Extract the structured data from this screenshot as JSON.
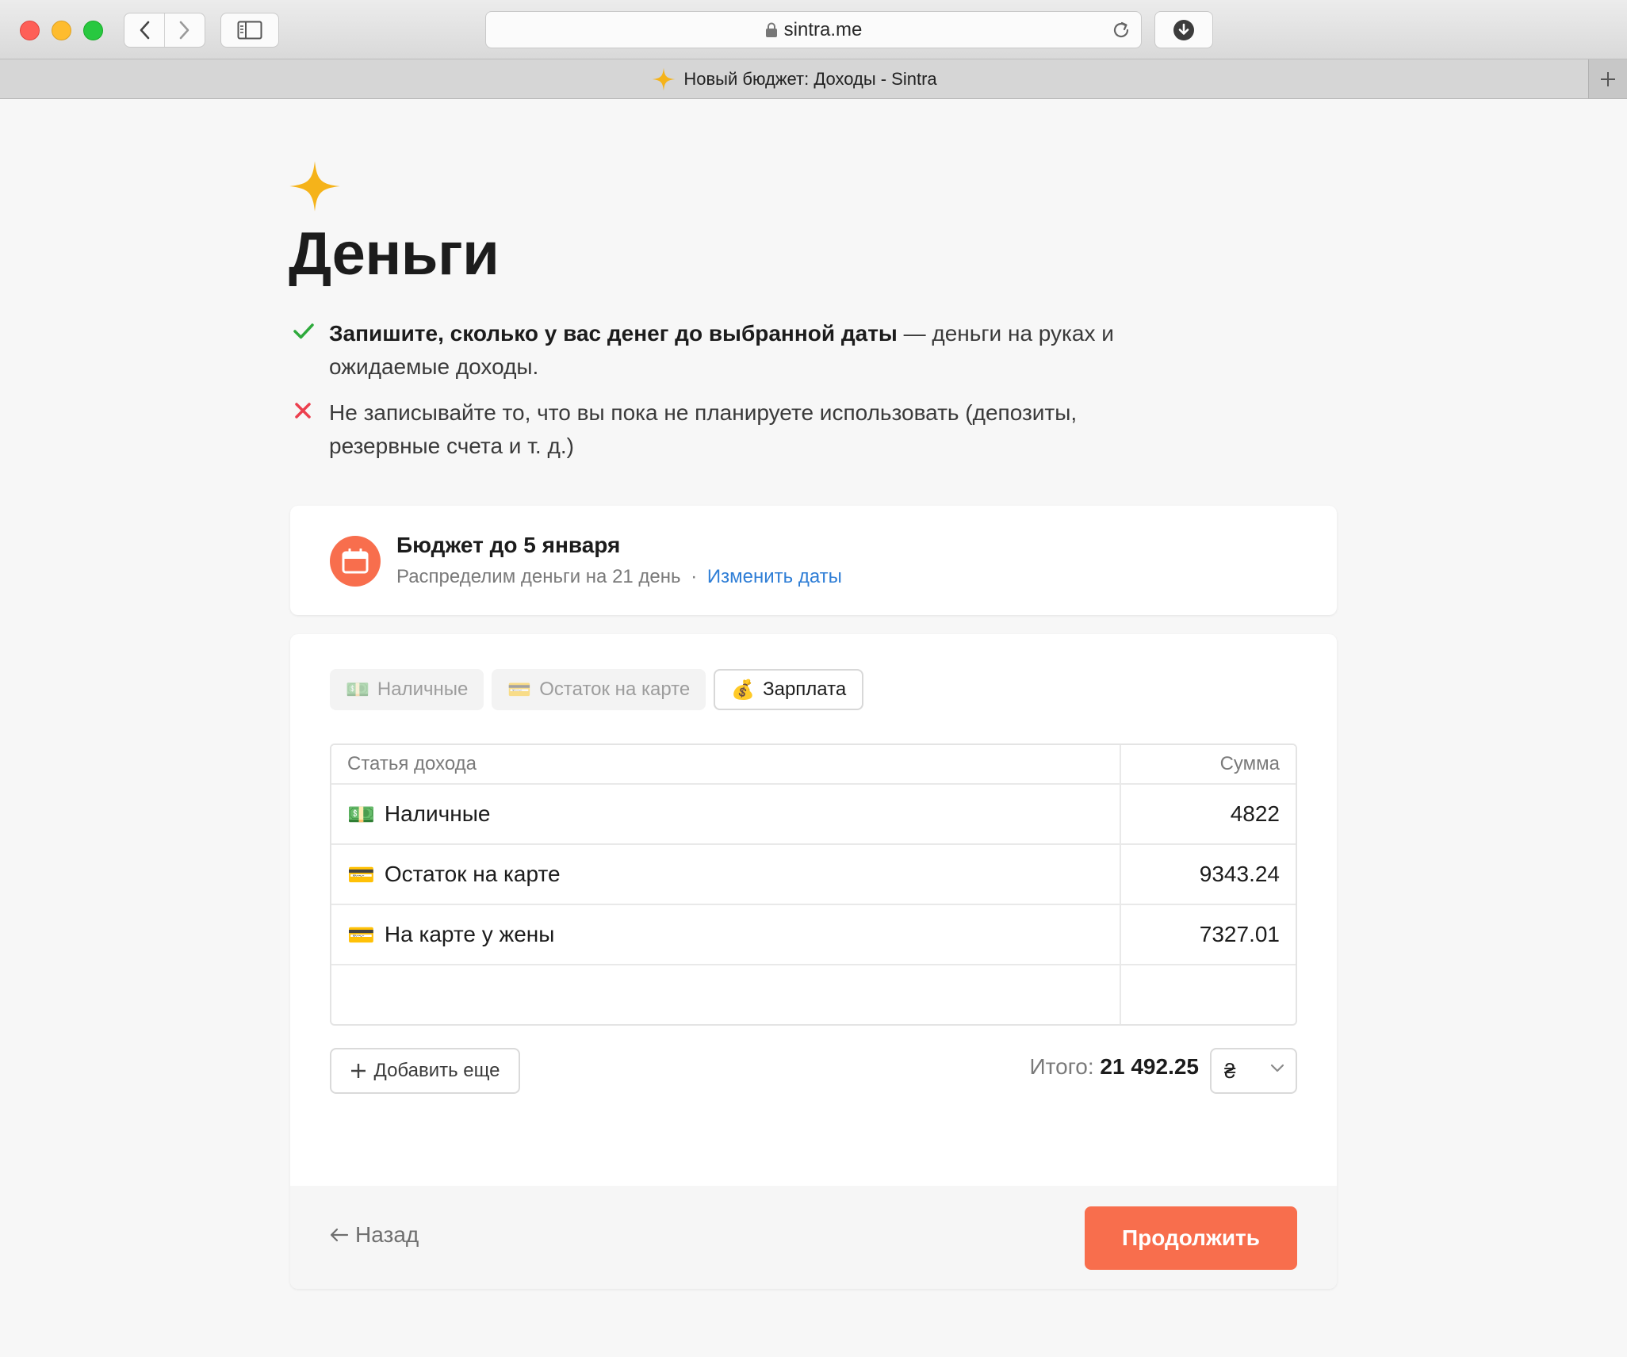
{
  "browser": {
    "url": "sintra.me",
    "tab_title": "Новый бюджет: Доходы - Sintra"
  },
  "page": {
    "title": "Деньги",
    "rules": [
      {
        "kind": "do",
        "bold": "Запишите, сколько у вас денег до выбранной даты",
        "rest": " — деньги на руках и ожидаемые доходы."
      },
      {
        "kind": "dont",
        "text": "Не записывайте то, что вы пока не планируете использовать (депозиты, резервные счета и т. д.)"
      }
    ]
  },
  "budget": {
    "title": "Бюджет до 5 января",
    "subtitle": "Распределим деньги на 21 день",
    "separator": "·",
    "change_dates_label": "Изменить даты"
  },
  "chips": [
    {
      "emoji": "💵",
      "label": "Наличные",
      "state": "used"
    },
    {
      "emoji": "💳",
      "label": "Остаток на карте",
      "state": "used"
    },
    {
      "emoji": "💰",
      "label": "Зарплата",
      "state": "available"
    }
  ],
  "table": {
    "headers": {
      "name": "Статья дохода",
      "amount": "Сумма"
    },
    "rows": [
      {
        "emoji": "💵",
        "name": "Наличные",
        "amount": "4822"
      },
      {
        "emoji": "💳",
        "name": "Остаток на карте",
        "amount": "9343.24"
      },
      {
        "emoji": "💳",
        "name": "На карте у жены",
        "amount": "7327.01"
      },
      {
        "emoji": "",
        "name": "",
        "amount": ""
      }
    ]
  },
  "actions": {
    "add_more_label": "Добавить еще",
    "total_label": "Итого:",
    "total_value": "21 492.25",
    "currency_symbol": "₴",
    "back_label": "Назад",
    "continue_label": "Продолжить"
  },
  "colors": {
    "accent": "#f86e4d",
    "star": "#f5b31a",
    "link": "#2f7ed6",
    "check": "#2eaa3c",
    "cross": "#ec3f4e"
  }
}
